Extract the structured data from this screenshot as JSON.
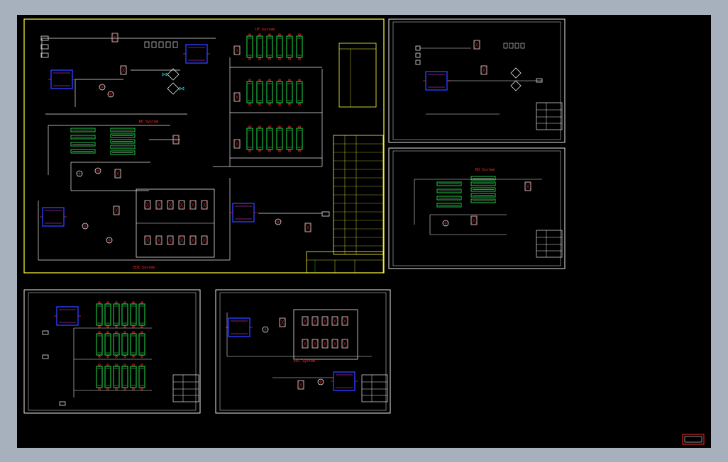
{
  "labels": {
    "uf_system": "UF System",
    "ro_system": "RO System",
    "edi_system": "EDI System",
    "ro_sheet": "RO System",
    "edi_sheet": "EDI System"
  },
  "colors": {
    "background": "#000000",
    "frame": "#ffff3c",
    "line": "#e8e8e8",
    "label": "#ff3030",
    "membrane": "#21e04a",
    "tank": "#2a3cff",
    "valve": "#22d8e8"
  }
}
